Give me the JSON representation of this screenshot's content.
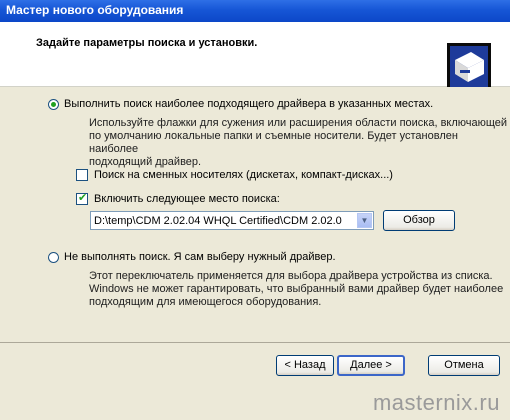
{
  "window": {
    "title": "Мастер нового оборудования"
  },
  "header": {
    "title": "Задайте параметры поиска и установки."
  },
  "option_search": {
    "label": "Выполнить поиск наиболее подходящего драйвера в указанных местах.",
    "selected": true,
    "description": [
      "Используйте флажки для сужения или расширения области поиска, включающей",
      "по умолчанию локальные папки и съемные носители. Будет установлен наиболее",
      "подходящий драйвер."
    ],
    "removable_media": {
      "label": "Поиск на сменных носителях (дискетах, компакт-дисках...)",
      "checked": false
    },
    "include_location": {
      "label": "Включить следующее место поиска:",
      "checked": true
    },
    "path_value": "D:\\temp\\CDM 2.02.04 WHQL Certified\\CDM 2.02.0",
    "browse_label": "Обзор"
  },
  "option_manual": {
    "label": "Не выполнять поиск. Я сам выберу нужный драйвер.",
    "selected": false,
    "description": [
      "Этот переключатель применяется для выбора драйвера устройства из списка.",
      "Windows не может гарантировать, что выбранный вами драйвер будет наиболее",
      "подходящим для имеющегося оборудования."
    ]
  },
  "footer": {
    "back_label": "< Назад",
    "next_label": "Далее >",
    "cancel_label": "Отмена"
  },
  "watermark": "masternix.ru",
  "icons": {
    "wizard": "hardware-wizard-icon",
    "combo_arrow": "chevron-down-icon"
  }
}
